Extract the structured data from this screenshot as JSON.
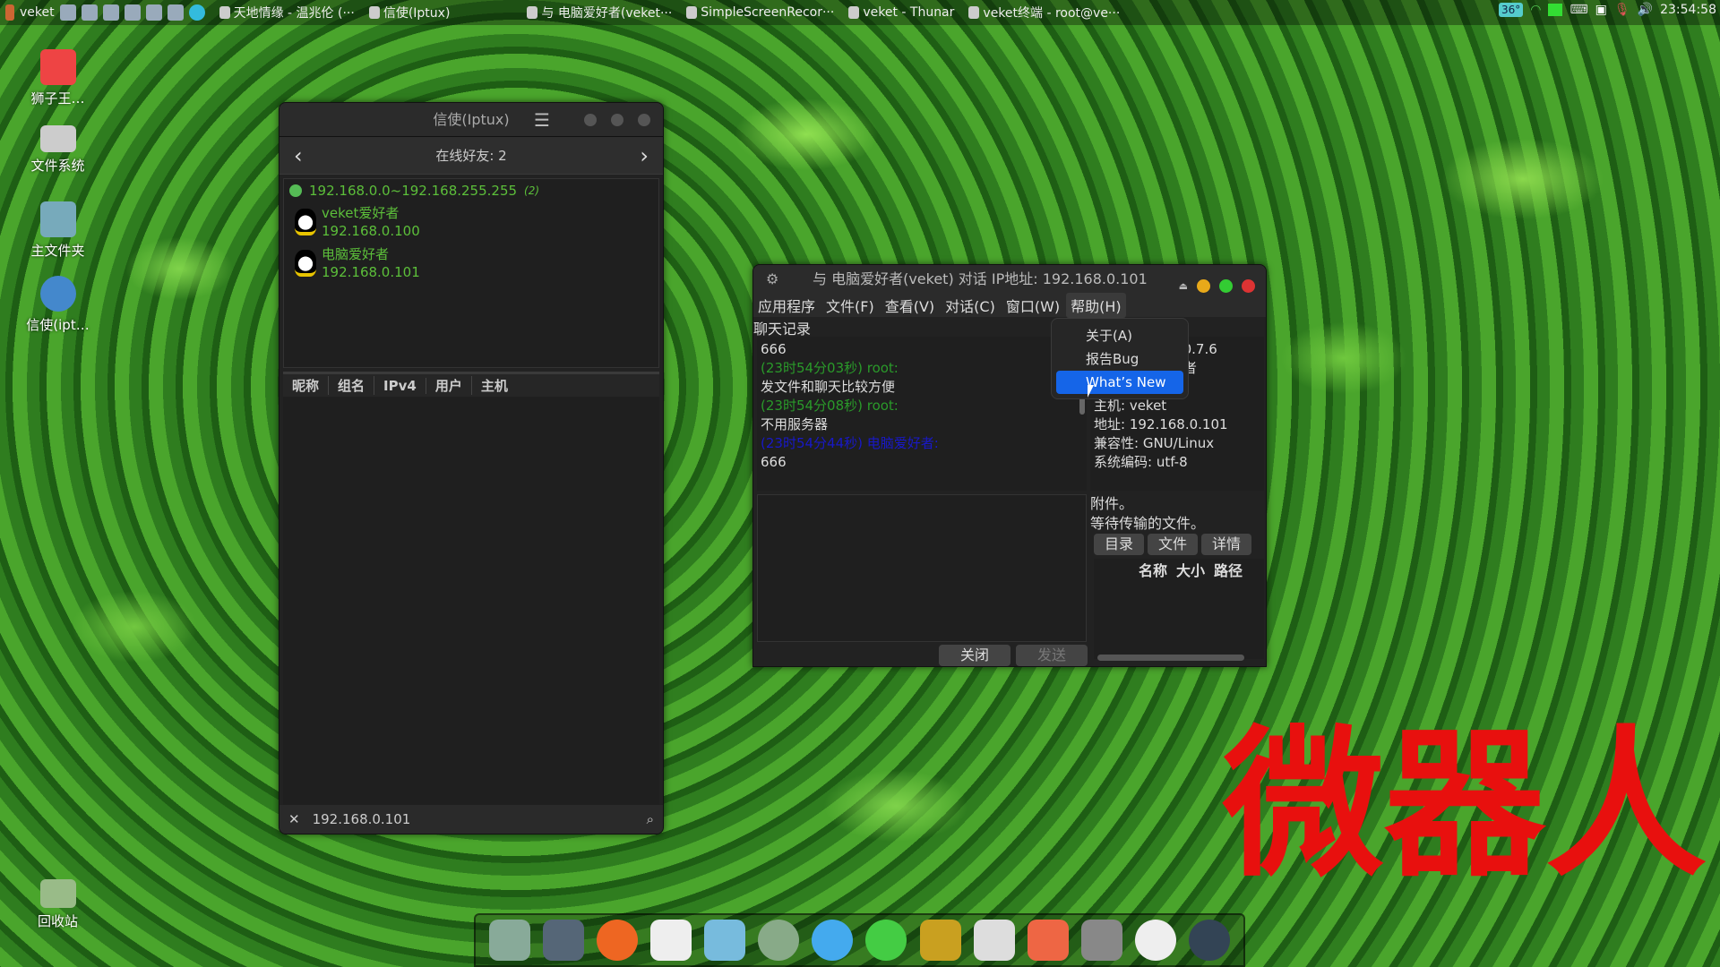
{
  "topbar": {
    "menu_label": "veket",
    "tasks": [
      "天地情缘 - 温兆伦 (···",
      "信使(Iptux)",
      "与 电脑爱好者(veket···",
      "SimpleScreenRecor···",
      "veket - Thunar",
      "veket终端 - root@ve···"
    ],
    "temperature": "36°",
    "clock": "23:54:58"
  },
  "desktop": [
    "狮子王…",
    "文件系统",
    "主文件夹",
    "信使(ipt…",
    "回收站"
  ],
  "iptux": {
    "title": "信使(Iptux)",
    "online": "在线好友: 2",
    "group": "192.168.0.0~192.168.255.255",
    "group_count": "(2)",
    "peers": [
      {
        "name": "veket爱好者",
        "ip": "192.168.0.100"
      },
      {
        "name": "电脑爱好者",
        "ip": "192.168.0.101"
      }
    ],
    "columns": [
      "昵称",
      "组名",
      "IPv4",
      "用户",
      "主机"
    ],
    "search_value": "192.168.0.101"
  },
  "chat": {
    "title": "与 电脑爱好者(veket) 对话 IP地址: 192.168.0.101",
    "menu": [
      "应用程序",
      "文件(F)",
      "查看(V)",
      "对话(C)",
      "窗口(W)",
      "帮助(H)"
    ],
    "history_label": "聊天记录",
    "messages": [
      {
        "text": "666",
        "c": ""
      },
      {
        "text": "(23时54分03秒) root:",
        "c": "g"
      },
      {
        "text": "发文件和聊天比较方便",
        "c": ""
      },
      {
        "text": "(23时54分08秒) root:",
        "c": "g"
      },
      {
        "text": "不用服务器",
        "c": ""
      },
      {
        "text": "(23时54分44秒) 电脑爱好者:",
        "c": "b"
      },
      {
        "text": "666",
        "c": ""
      }
    ],
    "info": [
      "版本: 1_iptux 0.7.6",
      "昵称: 电脑爱好者",
      "",
      "主机: veket",
      "地址: 192.168.0.101",
      "兼容性: GNU/Linux",
      "系统编码: utf-8"
    ],
    "attach_label": "附件。",
    "waiting_label": "等待传输的文件。",
    "file_buttons": [
      "目录",
      "文件",
      "详情"
    ],
    "file_columns": [
      "名称",
      "大小",
      "路径"
    ],
    "close_label": "关闭",
    "send_label": "发送"
  },
  "help_menu": [
    "关于(A)",
    "报告Bug",
    "What’s New"
  ],
  "watermark": "微器人"
}
